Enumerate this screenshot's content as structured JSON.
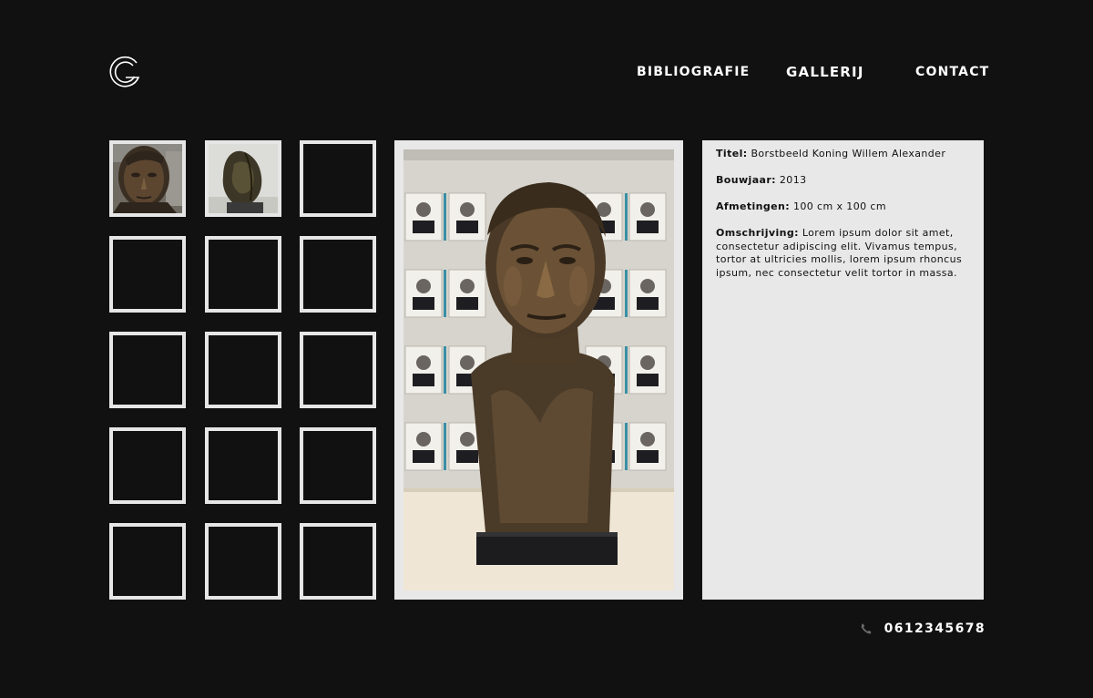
{
  "logo": {
    "icon": "g-logo-icon"
  },
  "nav": {
    "items": [
      {
        "label": "BIBLIOGRAFIE",
        "active": false
      },
      {
        "label": "GALLERIJ",
        "active": true
      },
      {
        "label": "CONTACT",
        "active": false
      }
    ]
  },
  "gallery": {
    "thumbnails": [
      {
        "image": "bust-face-thumbnail"
      },
      {
        "image": "abstract-stone-sculpture-thumbnail"
      },
      {
        "image": "empty"
      },
      {
        "image": "empty"
      },
      {
        "image": "empty"
      },
      {
        "image": "empty"
      },
      {
        "image": "empty"
      },
      {
        "image": "empty"
      },
      {
        "image": "empty"
      },
      {
        "image": "empty"
      },
      {
        "image": "empty"
      },
      {
        "image": "empty"
      },
      {
        "image": "empty"
      },
      {
        "image": "empty"
      },
      {
        "image": "empty"
      }
    ],
    "main_image": "bronze-bust-photo"
  },
  "details": {
    "title_label": "Titel:",
    "title_value": "Borstbeeld Koning Willem Alexander",
    "year_label": "Bouwjaar:",
    "year_value": "2013",
    "size_label": "Afmetingen:",
    "size_value": "100 cm x 100 cm",
    "desc_label": "Omschrijving:",
    "desc_value": "Lorem ipsum dolor sit amet, consectetur adipiscing elit. Vivamus tempus, tortor at ultricies mollis, lorem ipsum rhoncus ipsum, nec consectetur velit tortor in massa."
  },
  "contact": {
    "phone_icon": "phone-icon",
    "phone": "0612345678"
  },
  "colors": {
    "background": "#111111",
    "panel": "#e8e8e8",
    "thumb_border": "#e6e6e6",
    "text_light": "#ffffff",
    "text_dark": "#111111"
  }
}
